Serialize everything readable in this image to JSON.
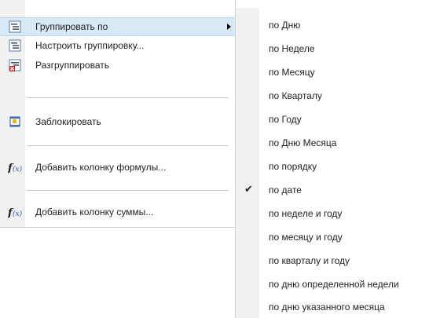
{
  "context_menu": {
    "items": [
      {
        "label": "Группировать по",
        "icon": "group-by-icon",
        "has_submenu": true,
        "highlighted": true
      },
      {
        "label": "Настроить группировку...",
        "icon": "configure-grouping-icon"
      },
      {
        "label": "Разгруппировать",
        "icon": "ungroup-icon"
      },
      {
        "label": "Заблокировать",
        "icon": "lock-column-icon"
      },
      {
        "label": "Добавить колонку формулы...",
        "icon": "formula-icon"
      },
      {
        "label": "Добавить колонку суммы...",
        "icon": "formula-icon"
      }
    ]
  },
  "submenu": {
    "items": [
      {
        "label": "по Дню"
      },
      {
        "label": "по Неделе"
      },
      {
        "label": "по Месяцу"
      },
      {
        "label": "по Кварталу"
      },
      {
        "label": "по Году"
      },
      {
        "label": "по Дню Месяца"
      },
      {
        "label": "по порядку"
      },
      {
        "label": "по дате",
        "checked": true
      },
      {
        "label": "по неделе и году"
      },
      {
        "label": "по месяцу и году"
      },
      {
        "label": "по кварталу и году"
      },
      {
        "label": "по дню определенной недели"
      },
      {
        "label": "по дню указанного месяца"
      }
    ],
    "check_glyph": "✔"
  },
  "colors": {
    "highlight": "#d7e8f7",
    "gutter": "#f1f1f1",
    "separator": "#c8c8c8"
  }
}
